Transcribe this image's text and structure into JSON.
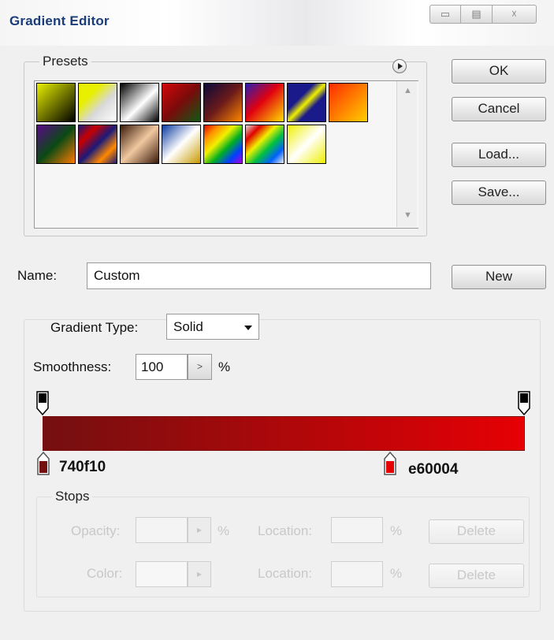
{
  "window": {
    "title": "Gradient Editor",
    "controls": {
      "minimize": "▭",
      "maximize": "▤",
      "close": "☓"
    }
  },
  "presets": {
    "label": "Presets",
    "menu_icon": "circle-arrow-right-icon",
    "swatches": [
      {
        "css": "linear-gradient(135deg,#e8f000 0%,#000 100%)"
      },
      {
        "css": "linear-gradient(135deg,#e8f000 0%,#e8f000 30%,#d8d8d8 60%,#ffffff 100%)"
      },
      {
        "css": "linear-gradient(135deg,#000 0%,#fff 55%,#000 100%)"
      },
      {
        "css": "linear-gradient(135deg,#d4080a 0%,#7a0a0a 50%,#0f5a14 100%)"
      },
      {
        "css": "linear-gradient(135deg,#0a0a3a 0%,#6a1a1a 50%,#ff8800 100%)"
      },
      {
        "css": "linear-gradient(135deg,#2a1eb0 0%,#e00010 45%,#ffe000 100%)"
      },
      {
        "css": "linear-gradient(135deg,#1a1a8a 0%,#1a1a8a 35%,#f0f000 50%,#1a1a8a 65%,#1a1a8a 100%)"
      },
      {
        "css": "linear-gradient(135deg,#ff2a00 0%,#ffd000 100%)"
      },
      {
        "css": "linear-gradient(135deg,#5a0a8a 0%,#0a4a14 50%,#ff7a00 100%)"
      },
      {
        "css": "linear-gradient(135deg,#1a1a7a 0%,#c80000 25%,#1a1a7a 50%,#ff8800 75%,#1a1a7a 100%)"
      },
      {
        "css": "linear-gradient(135deg,#3a1a0a 0%,#f0c8a0 50%,#3a1a0a 100%)"
      },
      {
        "css": "linear-gradient(135deg,#0a3aa0 0%,#ffffff 50%,#c89a00 100%)"
      },
      {
        "css": "linear-gradient(135deg,#e00000 0%,#ff9000 20%,#f0f000 40%,#00b020 60%,#0040ff 80%,#b000e0 100%)"
      },
      {
        "css": "linear-gradient(135deg,#dddddd 0%,#e00000 20%,#f0f000 40%,#00c040 60%,#0060ff 80%,#eeeeee 100%)"
      },
      {
        "css": "linear-gradient(135deg,#f0f000 0%,#ffffff 50%,#f0f000 100%)"
      }
    ]
  },
  "buttons": {
    "ok": "OK",
    "cancel": "Cancel",
    "load": "Load...",
    "save": "Save...",
    "new": "New"
  },
  "name_field": {
    "label": "Name:",
    "value": "Custom"
  },
  "gradient_type": {
    "label": "Gradient Type:",
    "selected": "Solid"
  },
  "smoothness": {
    "label": "Smoothness:",
    "value": "100",
    "unit": "%"
  },
  "gradient": {
    "start_color": "#740f10",
    "end_color": "#e60004",
    "start_label": "740f10",
    "end_label": "e60004"
  },
  "stops": {
    "label": "Stops",
    "opacity_label": "Opacity:",
    "opacity_unit": "%",
    "color_label": "Color:",
    "location_label": "Location:",
    "location_unit": "%",
    "delete_label": "Delete"
  }
}
